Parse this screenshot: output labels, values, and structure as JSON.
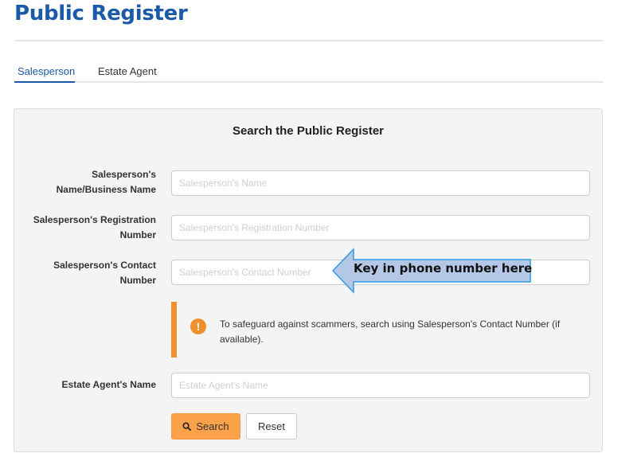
{
  "header": {
    "title": "Public Register"
  },
  "tabs": [
    {
      "label": "Salesperson",
      "active": true
    },
    {
      "label": "Estate Agent",
      "active": false
    }
  ],
  "form": {
    "title": "Search the Public Register",
    "fields": [
      {
        "label_line1": "Salesperson's",
        "label_line2": "Name/Business Name",
        "placeholder": "Salesperson's Name",
        "value": ""
      },
      {
        "label_line1": "Salesperson's Registration",
        "label_line2": "Number",
        "placeholder": "Salesperson's Registration Number",
        "value": ""
      },
      {
        "label_line1": "Salesperson's Contact",
        "label_line2": "Number",
        "placeholder": "Salesperson's Contact Number",
        "value": ""
      },
      {
        "label_line1": "Estate Agent's Name",
        "label_line2": "",
        "placeholder": "Estate Agent's Name",
        "value": ""
      }
    ],
    "alert": {
      "icon": "exclamation-icon",
      "text": "To safeguard against scammers, search using Salesperson's Contact Number (if available)."
    },
    "buttons": {
      "search_label": "Search",
      "reset_label": "Reset"
    }
  },
  "annotation": {
    "text": "Key in phone number here",
    "fill_color": "#b4c7e7",
    "stroke_color": "#2e9be0"
  },
  "colors": {
    "brand": "#1a5aa6",
    "warning": "#f0902c",
    "search_button": "#fba24a"
  }
}
